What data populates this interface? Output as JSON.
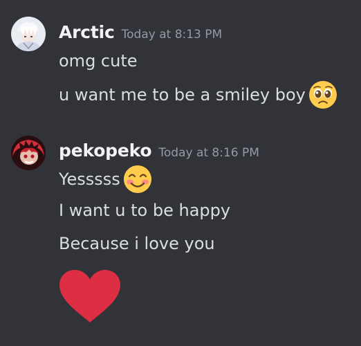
{
  "messages": [
    {
      "username": "Arctic",
      "timestamp": "Today at 8:13 PM",
      "avatar_icon": "arctic-avatar",
      "lines": [
        {
          "text": "omg cute",
          "emoji": null
        },
        {
          "text": "u want me to be a smiley boy",
          "emoji": "pleading-face-emoji"
        }
      ]
    },
    {
      "username": "pekopeko",
      "timestamp": "Today at 8:16 PM",
      "avatar_icon": "pekopeko-avatar",
      "lines": [
        {
          "text": "Yesssss",
          "emoji": "smiling-face-emoji"
        },
        {
          "text": "I want u to be happy",
          "emoji": null
        },
        {
          "text": "Because i love you",
          "emoji": null
        }
      ],
      "attachment_emoji": "red-heart-emoji"
    }
  ],
  "colors": {
    "background": "#313338",
    "username": "#f2f3f5",
    "timestamp": "#949ba4",
    "message_text": "#dbdee1",
    "heart": "#dd2e44"
  }
}
